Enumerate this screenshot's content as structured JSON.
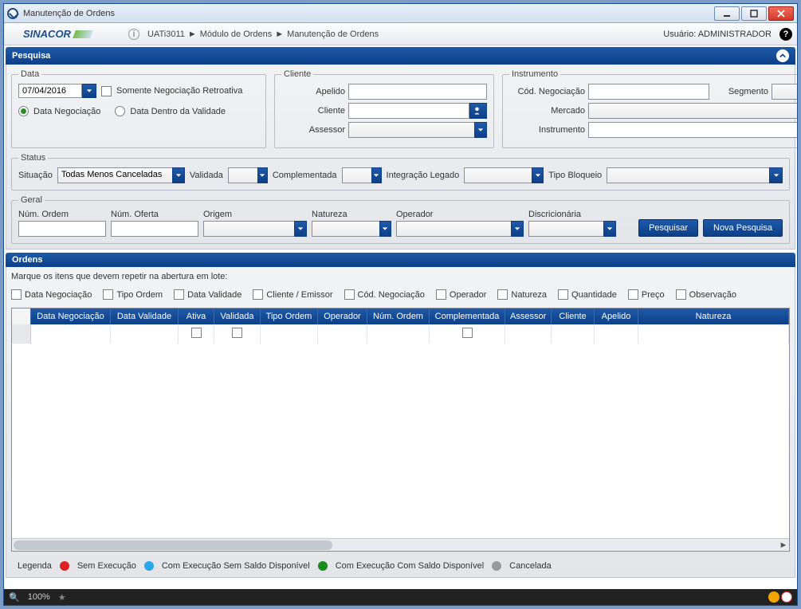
{
  "window": {
    "title": "Manutenção de Ordens"
  },
  "header": {
    "brand": "SINACOR",
    "crumb1": "UATi3011",
    "crumb2": "Módulo de Ordens",
    "crumb3": "Manutenção de Ordens",
    "user_label": "Usuário:",
    "user_value": "ADMINISTRADOR"
  },
  "pesquisa": {
    "title": "Pesquisa",
    "data": {
      "legend": "Data",
      "date_value": "07/04/2016",
      "somente_label": "Somente Negociação Retroativa",
      "radio1": "Data Negociação",
      "radio2": "Data Dentro da Validade"
    },
    "cliente": {
      "legend": "Cliente",
      "apelido": "Apelido",
      "cliente": "Cliente",
      "assessor": "Assessor"
    },
    "instrumento": {
      "legend": "Instrumento",
      "cod": "Cód. Negociação",
      "segmento": "Segmento",
      "mercado": "Mercado",
      "instrumento": "Instrumento"
    },
    "status": {
      "legend": "Status",
      "situacao": "Situação",
      "situacao_val": "Todas Menos Canceladas",
      "validada": "Validada",
      "complementada": "Complementada",
      "integracao": "Integração Legado",
      "tipo_bloqueio": "Tipo Bloqueio"
    },
    "geral": {
      "legend": "Geral",
      "num_ordem": "Núm. Ordem",
      "num_oferta": "Núm. Oferta",
      "origem": "Origem",
      "natureza": "Natureza",
      "operador": "Operador",
      "discricionaria": "Discricionária",
      "btn_pesquisar": "Pesquisar",
      "btn_nova": "Nova Pesquisa"
    }
  },
  "ordens": {
    "title": "Ordens",
    "repeat_caption": "Marque os itens que devem repetir na abertura em lote:",
    "repeat_items": {
      "c1": "Data Negociação",
      "c2": "Tipo Ordem",
      "c3": "Data Validade",
      "c4": "Cliente / Emissor",
      "c5": "Cód. Negociação",
      "c6": "Operador",
      "c7": "Natureza",
      "c8": "Quantidade",
      "c9": "Preço",
      "c10": "Observação"
    },
    "columns": {
      "h1": "Data Negociação",
      "h2": "Data Validade",
      "h3": "Ativa",
      "h4": "Validada",
      "h5": "Tipo Ordem",
      "h6": "Operador",
      "h7": "Núm. Ordem",
      "h8": "Complementada",
      "h9": "Assessor",
      "h10": "Cliente",
      "h11": "Apelido",
      "h12": "Natureza"
    }
  },
  "legend": {
    "title": "Legenda",
    "l1": "Sem Execução",
    "l2": "Com Execução Sem Saldo Disponível",
    "l3": "Com Execução Com Saldo Disponível",
    "l4": "Cancelada",
    "colors": {
      "l1": "#d22",
      "l2": "#2aa7e8",
      "l3": "#1a8a1a",
      "l4": "#9a9a9a"
    }
  },
  "footer": {
    "zoom": "100%"
  }
}
